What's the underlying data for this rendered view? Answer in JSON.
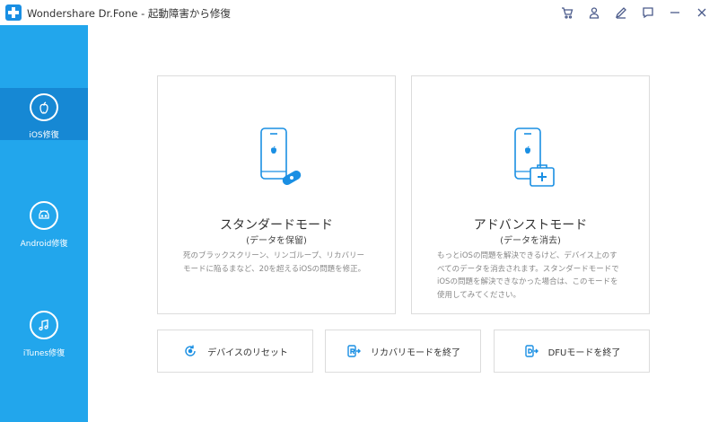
{
  "window": {
    "title": "Wondershare Dr.Fone - 起動障害から修復",
    "icons": [
      "cart-icon",
      "user-icon",
      "edit-icon",
      "feedback-icon",
      "minimize-icon",
      "close-icon"
    ]
  },
  "sidebar": {
    "items": [
      {
        "label": "iOS修復",
        "icon": "apple-icon",
        "active": true
      },
      {
        "label": "Android修復",
        "icon": "android-icon",
        "active": false
      },
      {
        "label": "iTunes修復",
        "icon": "music-note-icon",
        "active": false
      }
    ]
  },
  "main": {
    "modes": [
      {
        "title": "スタンダードモード",
        "subtitle": "(データを保留)",
        "description": [
          "死のブラックスクリーン、リンゴループ、リカバリー",
          "モードに陥るまなど、20を超えるiOSの問題を修正。"
        ],
        "icon": "phone-bandage-icon"
      },
      {
        "title": "アドバンストモード",
        "subtitle": "(データを消去)",
        "description": [
          "もっとiOSの問題を解決できるけど、デバイス上のす",
          "べてのデータを消去されます。スタンダードモードで",
          "iOSの問題を解決できなかった場合は、このモードを",
          "使用してみてください。"
        ],
        "icon": "phone-firstaid-icon"
      }
    ],
    "actions": [
      {
        "label": "デバイスのリセット",
        "icon": "reset-icon"
      },
      {
        "label": "リカバリモードを終了",
        "icon": "recovery-exit-icon"
      },
      {
        "label": "DFUモードを終了",
        "icon": "dfu-exit-icon"
      }
    ]
  },
  "colors": {
    "sidebar": "#22a6ec",
    "sidebar_active": "#1688d4",
    "accent": "#1a8fe3"
  }
}
